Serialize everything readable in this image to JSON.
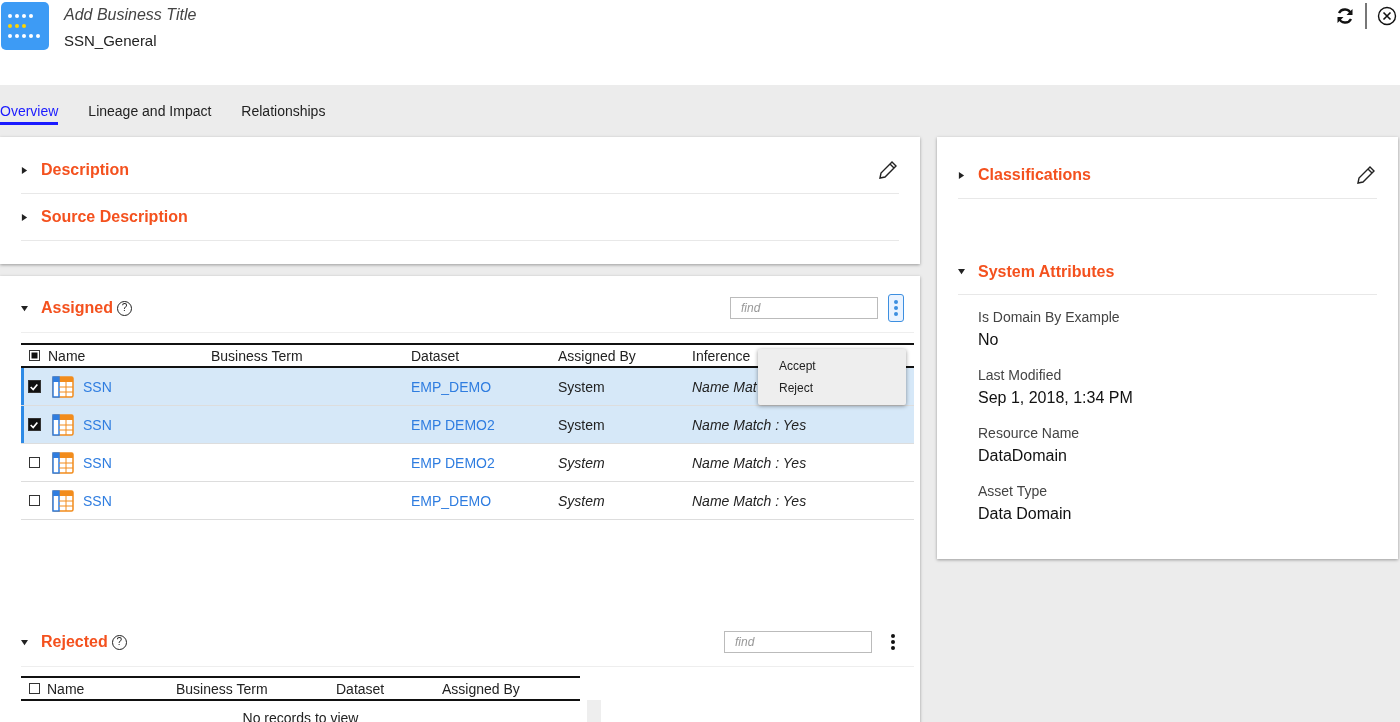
{
  "header": {
    "title": "Add Business Title",
    "subtitle": "SSN_General"
  },
  "tabs": [
    {
      "label": "Overview",
      "selected": true
    },
    {
      "label": "Lineage and Impact",
      "selected": false
    },
    {
      "label": "Relationships",
      "selected": false
    }
  ],
  "top_sections": [
    {
      "title": "Description",
      "expanded": false
    },
    {
      "title": "Source Description",
      "expanded": false
    }
  ],
  "assigned": {
    "title": "Assigned",
    "expanded": true,
    "help": "?",
    "find_placeholder": "find",
    "select_all_partial": true,
    "columns": [
      "Name",
      "Business Term",
      "Dataset",
      "Assigned By",
      "Inference"
    ],
    "rows": [
      {
        "selected": true,
        "name": "SSN",
        "dataset": "EMP_DEMO",
        "assigned_by": "System",
        "inference": "Name Mat"
      },
      {
        "selected": true,
        "name": "SSN",
        "dataset": "EMP DEMO2",
        "assigned_by": "System",
        "inference": "Name Match : Yes"
      },
      {
        "selected": false,
        "name": "SSN",
        "dataset": "EMP DEMO2",
        "assigned_by": "System",
        "inference": "Name Match : Yes"
      },
      {
        "selected": false,
        "name": "SSN",
        "dataset": "EMP_DEMO",
        "assigned_by": "System",
        "inference": "Name Match : Yes"
      }
    ],
    "menu": [
      "Accept",
      "Reject"
    ]
  },
  "rejected": {
    "title": "Rejected",
    "expanded": true,
    "help": "?",
    "find_placeholder": "find",
    "select_all_partial": false,
    "columns": [
      "Name",
      "Business Term",
      "Dataset",
      "Assigned By"
    ],
    "empty": "No records to view"
  },
  "classifications": {
    "title": "Classifications",
    "expanded": false
  },
  "system_attributes": {
    "title": "System Attributes",
    "expanded": true,
    "items": [
      {
        "label": "Is Domain By Example",
        "value": "No"
      },
      {
        "label": "Last Modified",
        "value": "Sep 1, 2018, 1:34 PM"
      },
      {
        "label": "Resource Name",
        "value": "DataDomain"
      },
      {
        "label": "Asset Type",
        "value": "Data Domain"
      }
    ]
  }
}
